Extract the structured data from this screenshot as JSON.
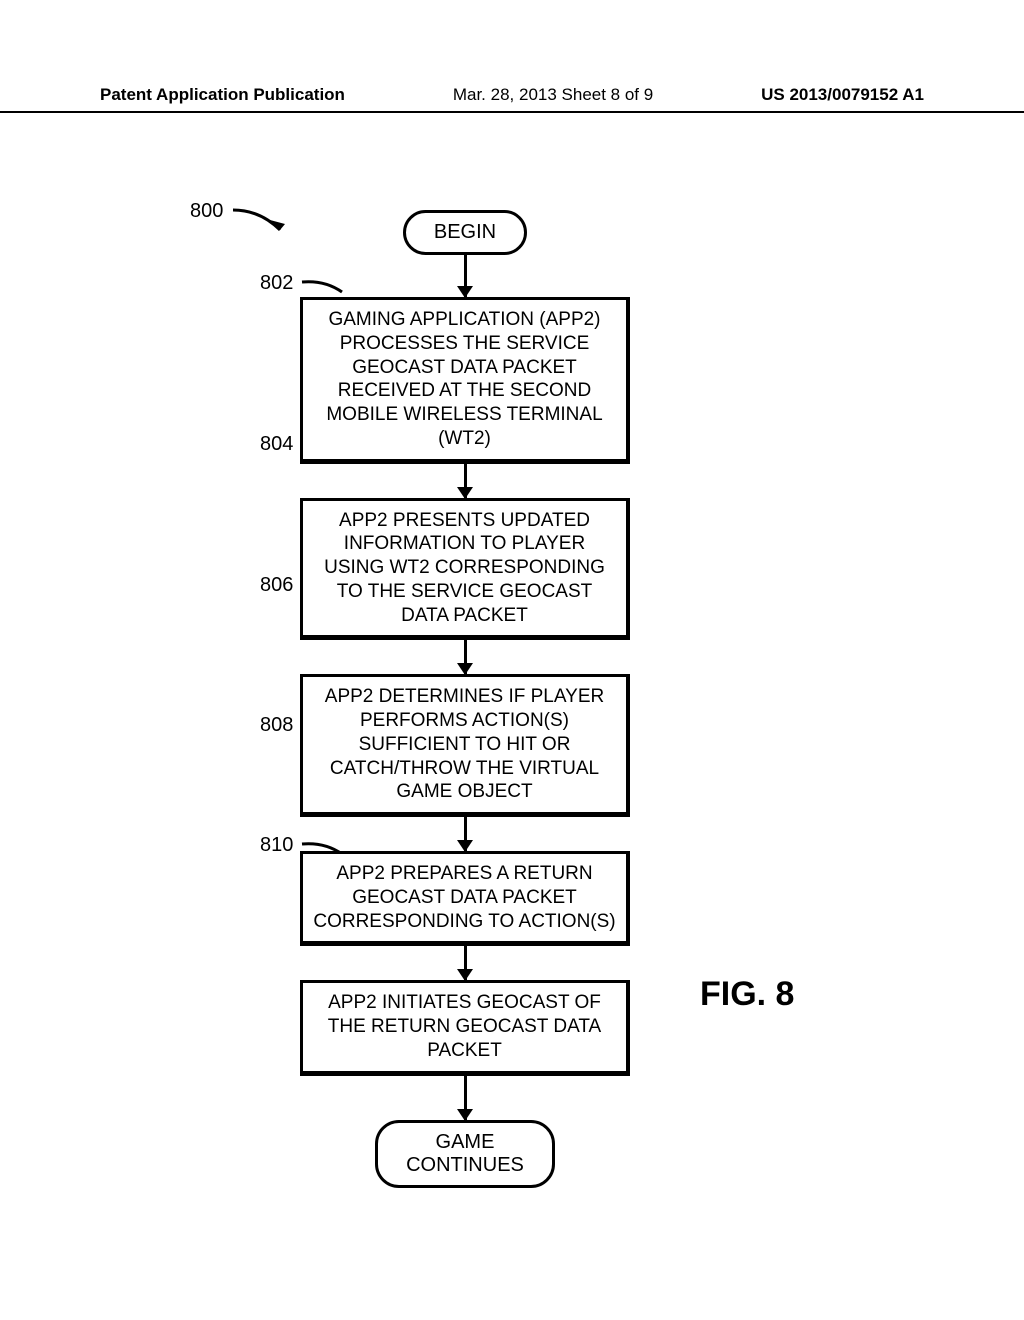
{
  "header": {
    "left": "Patent Application Publication",
    "mid": "Mar. 28, 2013  Sheet 8 of 9",
    "right": "US 2013/0079152 A1"
  },
  "refs": {
    "r800": "800",
    "r802": "802",
    "r804": "804",
    "r806": "806",
    "r808": "808",
    "r810": "810"
  },
  "blocks": {
    "begin": "BEGIN",
    "b802": "GAMING APPLICATION (APP2) PROCESSES THE SERVICE GEOCAST DATA PACKET RECEIVED AT THE SECOND MOBILE WIRELESS TERMINAL (WT2)",
    "b804": "APP2 PRESENTS UPDATED INFORMATION TO PLAYER USING WT2 CORRESPONDING TO THE SERVICE GEOCAST DATA PACKET",
    "b806": "APP2 DETERMINES IF PLAYER PERFORMS ACTION(S) SUFFICIENT TO HIT OR CATCH/THROW THE VIRTUAL GAME OBJECT",
    "b808": "APP2 PREPARES A RETURN GEOCAST DATA PACKET CORRESPONDING TO ACTION(S)",
    "b810": "APP2 INITIATES GEOCAST OF THE RETURN GEOCAST DATA PACKET",
    "end_l1": "GAME",
    "end_l2": "CONTINUES"
  },
  "figure_label": "FIG. 8"
}
